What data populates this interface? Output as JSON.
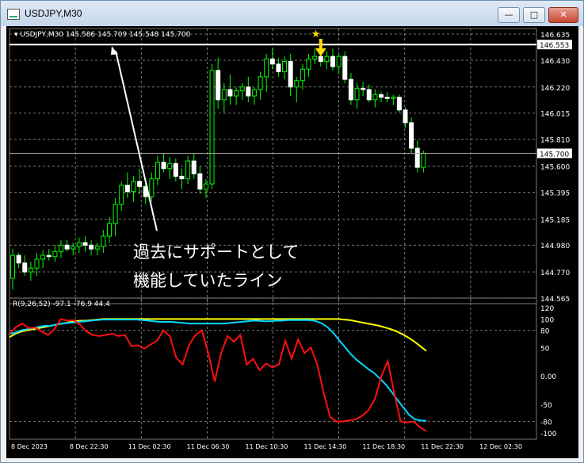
{
  "window": {
    "title": "USDJPY,M30",
    "min_label": "—",
    "max_label": "□",
    "close_label": "✕"
  },
  "chart_data": [
    {
      "type": "candlestick",
      "header": "USDJPY,M30  145.586 145.709 145.548 145.700",
      "ylim": [
        144.565,
        146.635
      ],
      "y_ticks": [
        "146.635",
        "146.430",
        "146.220",
        "146.015",
        "145.810",
        "145.600",
        "145.395",
        "145.185",
        "144.980",
        "144.770",
        "144.565"
      ],
      "price_tags": {
        "support_line": "146.553",
        "current": "145.700"
      },
      "support_line_value": 146.553,
      "current_price": 145.7,
      "candles": [
        [
          144.72,
          144.95,
          144.63,
          144.9
        ],
        [
          144.9,
          144.92,
          144.8,
          144.84
        ],
        [
          144.84,
          144.9,
          144.74,
          144.77
        ],
        [
          144.77,
          144.85,
          144.7,
          144.8
        ],
        [
          144.8,
          144.92,
          144.74,
          144.87
        ],
        [
          144.87,
          144.94,
          144.8,
          144.9
        ],
        [
          144.9,
          144.95,
          144.86,
          144.89
        ],
        [
          144.89,
          144.98,
          144.85,
          144.93
        ],
        [
          144.93,
          145.02,
          144.88,
          144.98
        ],
        [
          144.98,
          145.02,
          144.93,
          144.95
        ],
        [
          144.95,
          145.0,
          144.9,
          144.97
        ],
        [
          144.97,
          145.04,
          144.92,
          145.0
        ],
        [
          145.0,
          145.05,
          144.93,
          144.98
        ],
        [
          144.98,
          145.02,
          144.9,
          144.95
        ],
        [
          144.95,
          145.0,
          144.9,
          144.97
        ],
        [
          144.97,
          145.1,
          144.92,
          145.05
        ],
        [
          145.05,
          145.2,
          145.0,
          145.15
        ],
        [
          145.15,
          145.35,
          145.05,
          145.3
        ],
        [
          145.3,
          145.48,
          145.25,
          145.45
        ],
        [
          145.45,
          145.55,
          145.35,
          145.4
        ],
        [
          145.4,
          145.52,
          145.32,
          145.48
        ],
        [
          145.48,
          145.58,
          145.38,
          145.44
        ],
        [
          145.44,
          145.5,
          145.3,
          145.36
        ],
        [
          145.36,
          145.55,
          145.32,
          145.5
        ],
        [
          145.5,
          145.68,
          145.45,
          145.63
        ],
        [
          145.63,
          145.7,
          145.55,
          145.58
        ],
        [
          145.58,
          145.67,
          145.5,
          145.62
        ],
        [
          145.62,
          145.66,
          145.48,
          145.52
        ],
        [
          145.52,
          145.58,
          145.42,
          145.5
        ],
        [
          145.5,
          145.68,
          145.46,
          145.64
        ],
        [
          145.64,
          145.7,
          145.5,
          145.54
        ],
        [
          145.54,
          145.6,
          145.38,
          145.42
        ],
        [
          145.42,
          145.5,
          145.35,
          145.46
        ],
        [
          145.46,
          146.4,
          145.42,
          146.35
        ],
        [
          146.35,
          146.45,
          146.05,
          146.12
        ],
        [
          146.12,
          146.25,
          146.02,
          146.2
        ],
        [
          146.2,
          146.32,
          146.08,
          146.15
        ],
        [
          146.15,
          146.22,
          146.08,
          146.19
        ],
        [
          146.19,
          146.25,
          146.12,
          146.22
        ],
        [
          146.22,
          146.3,
          146.1,
          146.15
        ],
        [
          146.15,
          146.22,
          146.08,
          146.2
        ],
        [
          146.2,
          146.34,
          146.12,
          146.3
        ],
        [
          146.3,
          146.48,
          146.18,
          146.44
        ],
        [
          146.44,
          146.52,
          146.36,
          146.4
        ],
        [
          146.4,
          146.45,
          146.3,
          146.34
        ],
        [
          146.34,
          146.46,
          146.28,
          146.42
        ],
        [
          146.42,
          146.48,
          146.15,
          146.22
        ],
        [
          146.22,
          146.3,
          146.1,
          146.27
        ],
        [
          146.27,
          146.4,
          146.2,
          146.36
        ],
        [
          146.36,
          146.48,
          146.3,
          146.44
        ],
        [
          146.44,
          146.52,
          146.4,
          146.46
        ],
        [
          146.46,
          146.52,
          146.38,
          146.42
        ],
        [
          146.42,
          146.5,
          146.36,
          146.46
        ],
        [
          146.46,
          146.52,
          146.35,
          146.38
        ],
        [
          146.38,
          146.48,
          146.32,
          146.46
        ],
        [
          146.46,
          146.5,
          146.25,
          146.28
        ],
        [
          146.28,
          146.33,
          146.08,
          146.12
        ],
        [
          146.12,
          146.25,
          146.05,
          146.21
        ],
        [
          146.21,
          146.26,
          146.15,
          146.2
        ],
        [
          146.2,
          146.24,
          146.1,
          146.12
        ],
        [
          146.12,
          146.2,
          146.06,
          146.16
        ],
        [
          146.16,
          146.18,
          146.1,
          146.14
        ],
        [
          146.14,
          146.18,
          146.1,
          146.13
        ],
        [
          146.13,
          146.16,
          146.08,
          146.14
        ],
        [
          146.14,
          146.16,
          146.02,
          146.04
        ],
        [
          146.04,
          146.06,
          145.9,
          145.94
        ],
        [
          145.94,
          145.98,
          145.7,
          145.74
        ],
        [
          145.74,
          145.8,
          145.55,
          145.59
        ],
        [
          145.59,
          145.72,
          145.55,
          145.7
        ]
      ],
      "arrow_candle_index": 51,
      "star_label": "★",
      "annotation": {
        "line1": "過去にサポートとして",
        "line2": "機能していたライン"
      }
    },
    {
      "type": "line",
      "header": "R(9,26,52) -97.1 -76.9 44.4",
      "ylim": [
        -100,
        120
      ],
      "y_ticks": [
        "120",
        "100",
        "80",
        "50",
        "0.00",
        "-50",
        "-80",
        "-100"
      ],
      "levels": [
        80,
        -80
      ],
      "series": [
        {
          "color": "#ffff00",
          "values": [
            68,
            74,
            78,
            80,
            82,
            84,
            86,
            88,
            90,
            92,
            94,
            96,
            97,
            97,
            98,
            99,
            100,
            100,
            100,
            100,
            100,
            100,
            100,
            100,
            100,
            100,
            100,
            100,
            100,
            100,
            100,
            100,
            100,
            100,
            100,
            100,
            100,
            100,
            100,
            100,
            100,
            100,
            100,
            100,
            100,
            100,
            100,
            100,
            100,
            100,
            100,
            100,
            100,
            100,
            100,
            100,
            100,
            99,
            98,
            96,
            94,
            92,
            90,
            88,
            85,
            82,
            78,
            73,
            67,
            60,
            52,
            44
          ]
        },
        {
          "color": "#00d8ff",
          "values": [
            74,
            76,
            80,
            82,
            84,
            86,
            88,
            88,
            90,
            92,
            93,
            94,
            95,
            96,
            97,
            98,
            99,
            99,
            99,
            99,
            99,
            99,
            99,
            98,
            97,
            96,
            95,
            95,
            95,
            94,
            93,
            92,
            92,
            92,
            92,
            92,
            92,
            92,
            93,
            94,
            95,
            96,
            97,
            97,
            96,
            96,
            97,
            97,
            98,
            98,
            98,
            98,
            98,
            96,
            92,
            85,
            75,
            62,
            50,
            38,
            28,
            20,
            12,
            5,
            -5,
            -15,
            -28,
            -42,
            -55,
            -68,
            -76,
            -78,
            -79
          ]
        },
        {
          "color": "#ff1010",
          "values": [
            74,
            86,
            92,
            84,
            85,
            78,
            72,
            82,
            100,
            97,
            98,
            90,
            78,
            72,
            70,
            72,
            74,
            70,
            72,
            52,
            54,
            48,
            55,
            62,
            80,
            70,
            32,
            20,
            54,
            72,
            80,
            40,
            -10,
            40,
            70,
            60,
            72,
            20,
            30,
            10,
            22,
            15,
            20,
            62,
            30,
            64,
            40,
            50,
            20,
            -30,
            -72,
            -80,
            -80,
            -78,
            -76,
            -70,
            -60,
            -40,
            0,
            26,
            -30,
            -80,
            -82,
            -80,
            -90,
            -97
          ]
        }
      ]
    }
  ],
  "time_labels": [
    "8 Dec 2023",
    "8 Dec 22:30",
    "11 Dec 02:30",
    "11 Dec 06:30",
    "11 Dec 10:30",
    "11 Dec 14:30",
    "11 Dec 18:30",
    "11 Dec 22:30",
    "12 Dec 02:30"
  ],
  "colors": {
    "bg": "#000000",
    "up": "#ffffff",
    "down": "#ffffff",
    "grid": "#9a9a9a",
    "bull": "#00ff00",
    "text": "#ffffff",
    "arrow": "#ffdd00"
  }
}
